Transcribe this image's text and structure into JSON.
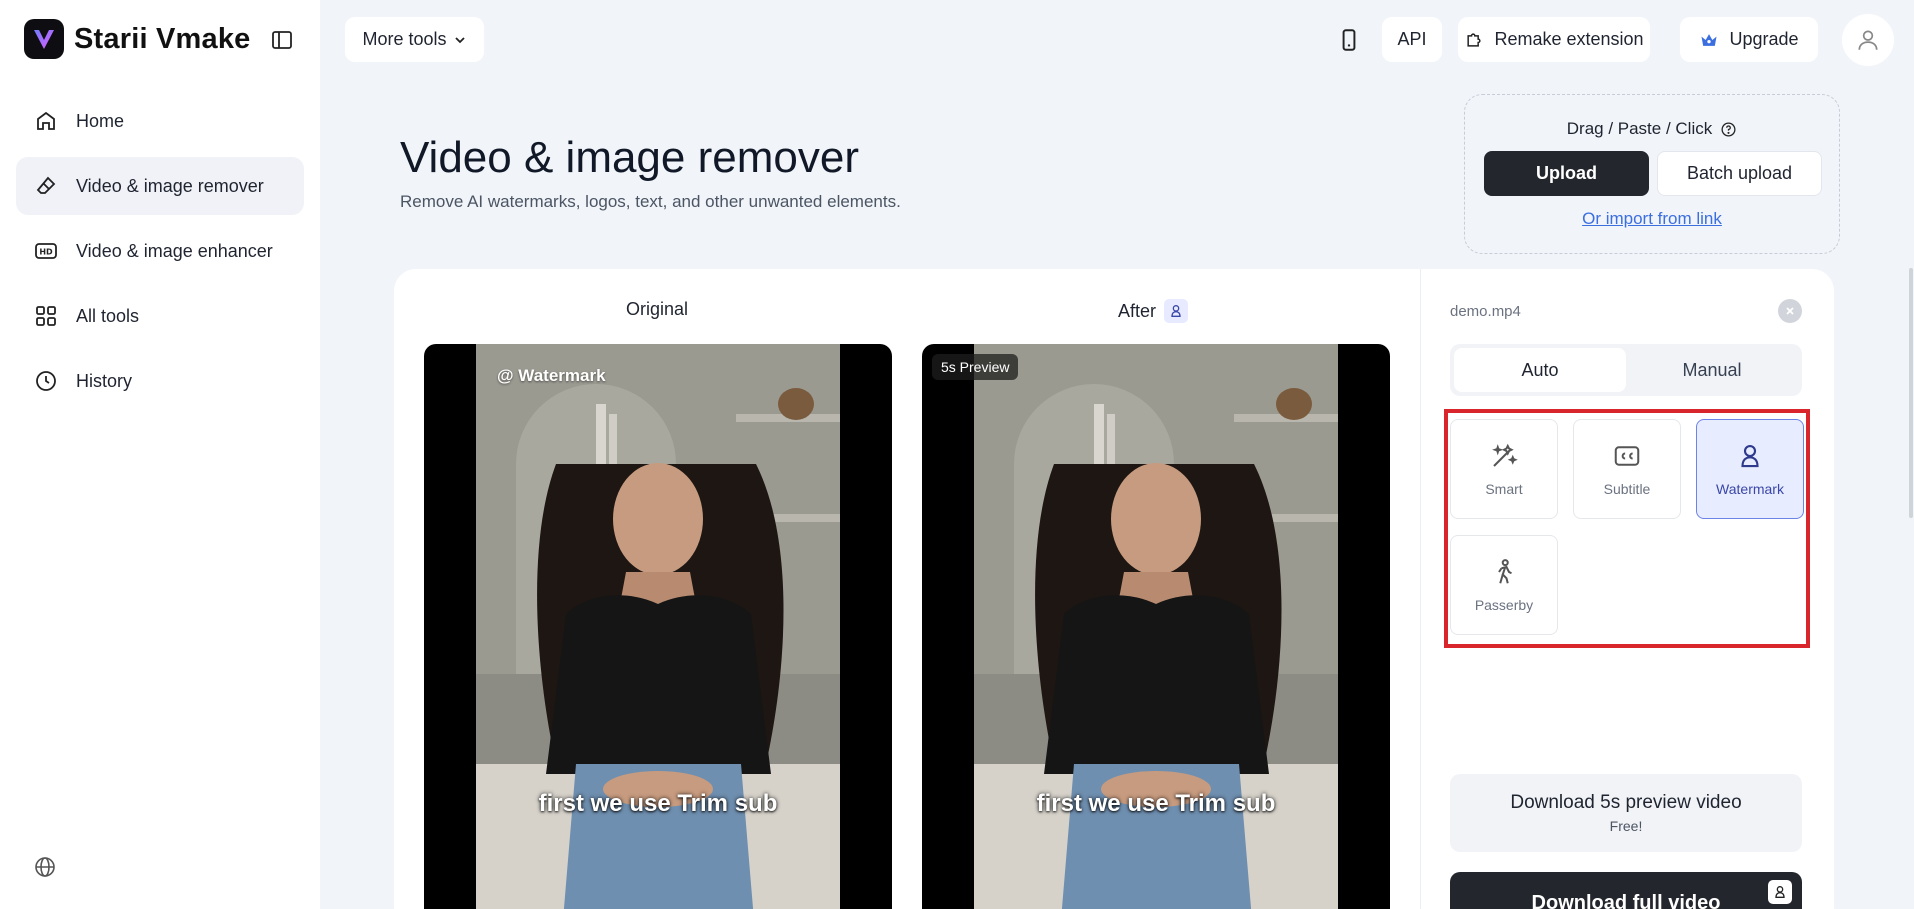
{
  "app": {
    "name": "Starii Vmake",
    "logo_icon": "vmake-logo-icon",
    "brand_colors": {
      "gradient_start": "#5b6cff",
      "gradient_end": "#d75bff"
    }
  },
  "sidebar": {
    "items": [
      {
        "label": "Home",
        "icon": "home-icon",
        "active": false
      },
      {
        "label": "Video & image remover",
        "icon": "eraser-icon",
        "active": true
      },
      {
        "label": "Video & image enhancer",
        "icon": "hd-icon",
        "active": false
      },
      {
        "label": "All tools",
        "icon": "grid-icon",
        "active": false
      },
      {
        "label": "History",
        "icon": "clock-icon",
        "active": false
      }
    ]
  },
  "topbar": {
    "more_tools": "More tools",
    "api": "API",
    "remake_extension": "Remake extension",
    "upgrade": "Upgrade"
  },
  "header": {
    "title": "Video & image remover",
    "subtitle": "Remove AI watermarks, logos, text, and other unwanted elements."
  },
  "upload": {
    "drag_label": "Drag / Paste / Click",
    "upload_button": "Upload",
    "batch_button": "Batch upload",
    "import_link": "Or import from link"
  },
  "preview": {
    "original_label": "Original",
    "after_label": "After",
    "watermark_text": "@ Watermark",
    "preview_badge": "5s Preview",
    "subtitle_text": "first we use Trim sub"
  },
  "panel": {
    "file_name": "demo.mp4",
    "tabs": [
      {
        "label": "Auto",
        "active": true
      },
      {
        "label": "Manual",
        "active": false
      }
    ],
    "options": [
      {
        "label": "Smart",
        "icon": "magic-wand-icon",
        "active": false
      },
      {
        "label": "Subtitle",
        "icon": "cc-icon",
        "active": false
      },
      {
        "label": "Watermark",
        "icon": "watermark-icon",
        "active": true
      },
      {
        "label": "Passerby",
        "icon": "walking-person-icon",
        "active": false
      }
    ],
    "download_preview": "Download 5s preview video",
    "download_preview_sub": "Free!",
    "download_full": "Download full video",
    "highlight_color": "#d9252c"
  }
}
